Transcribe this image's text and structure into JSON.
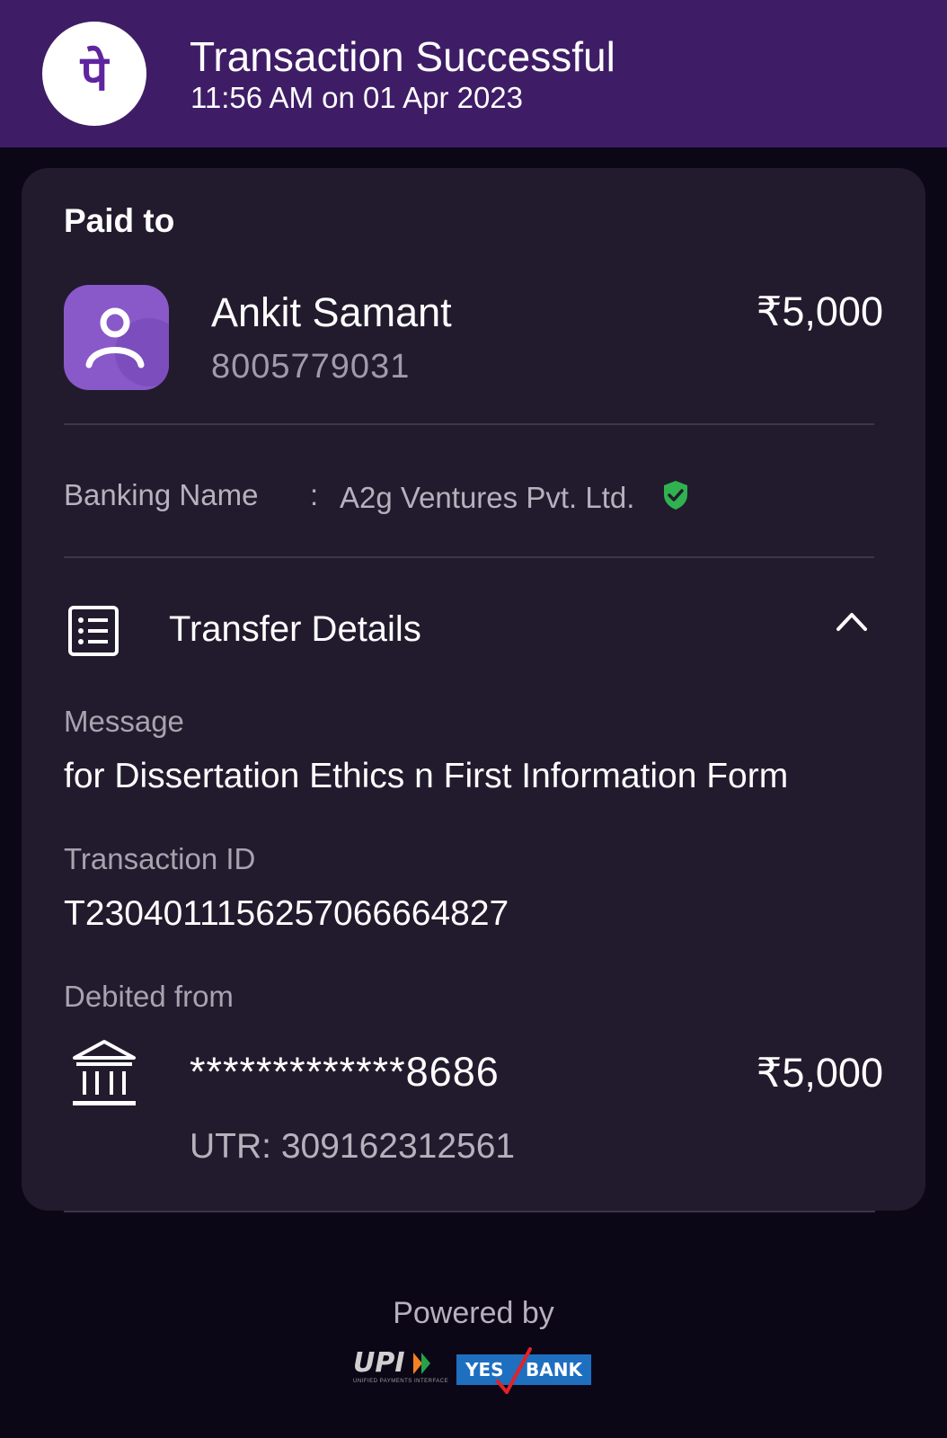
{
  "header": {
    "logo_glyph": "पे",
    "title": "Transaction Successful",
    "subtitle": "11:56 AM on 01 Apr 2023",
    "background": "#3f1d66"
  },
  "payment": {
    "section_label": "Paid to",
    "payee_name": "Ankit Samant",
    "payee_phone": "8005779031",
    "amount": "₹5,000",
    "banking_name_label": "Banking Name",
    "banking_name_separator": ":",
    "banking_name_value": "A2g Ventures Pvt. Ltd.",
    "verified_icon": "shield-check-icon",
    "verified_color": "#2fb24f"
  },
  "transfer_details": {
    "title": "Transfer Details",
    "expanded": true,
    "message_label": "Message",
    "message_value": "for Dissertation Ethics n First Information Form",
    "transaction_id_label": "Transaction ID",
    "transaction_id_value": "T2304011156257066664827",
    "debited_from_label": "Debited from",
    "account_masked": "*************8686",
    "debited_amount": "₹5,000",
    "utr": "UTR: 309162312561"
  },
  "footer": {
    "powered_by": "Powered by",
    "upi_logo": "UPI",
    "upi_tagline": "UNIFIED PAYMENTS INTERFACE",
    "bank_logo_left": "YES",
    "bank_logo_right": "BANK"
  }
}
